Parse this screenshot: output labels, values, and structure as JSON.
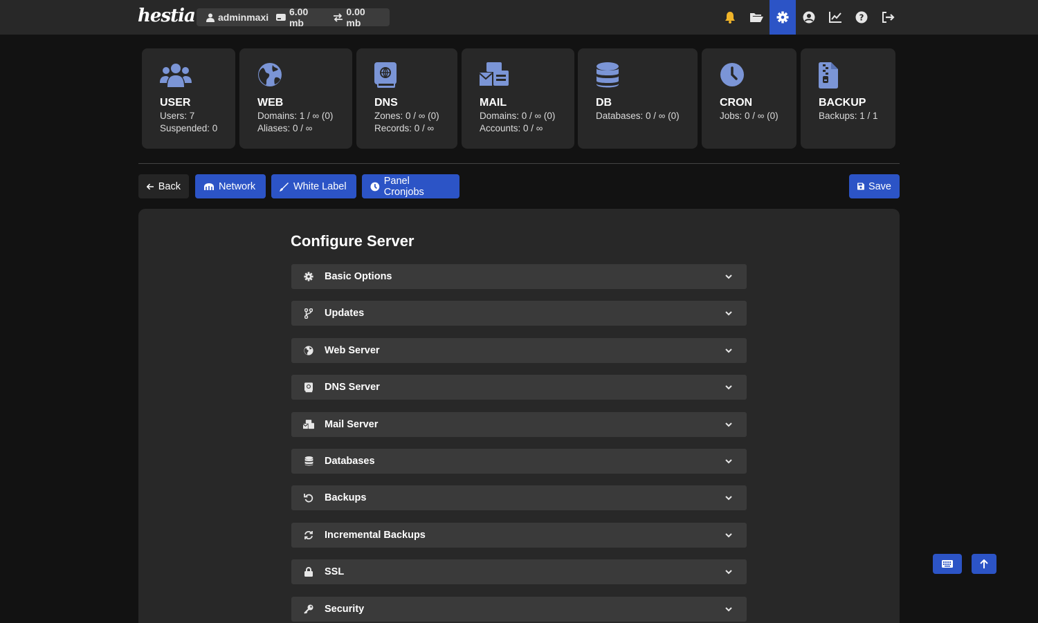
{
  "app": {
    "logo_text": "hestia"
  },
  "topbar": {
    "username": "adminmaxi",
    "disk": "6.00 mb",
    "bandwidth": "0.00 mb",
    "icons": [
      "bell-icon",
      "folder-icon",
      "gear-icon",
      "user-circle-icon",
      "chart-icon",
      "help-icon",
      "logout-icon"
    ],
    "accent": "#2c54c6",
    "bell_color": "#f0b429"
  },
  "stats": [
    {
      "title": "USER",
      "lines": [
        "Users: 7",
        "Suspended: 0"
      ],
      "icon": "users-icon"
    },
    {
      "title": "WEB",
      "lines": [
        "Domains: 1 / ∞ (0)",
        "Aliases: 0 / ∞"
      ],
      "icon": "globe-icon"
    },
    {
      "title": "DNS",
      "lines": [
        "Zones: 0 / ∞ (0)",
        "Records: 0 / ∞"
      ],
      "icon": "dns-book-icon"
    },
    {
      "title": "MAIL",
      "lines": [
        "Domains: 0 / ∞ (0)",
        "Accounts: 0 / ∞"
      ],
      "icon": "mail-bulk-icon"
    },
    {
      "title": "DB",
      "lines": [
        "Databases: 0 / ∞ (0)"
      ],
      "icon": "database-icon"
    },
    {
      "title": "CRON",
      "lines": [
        "Jobs: 0 / ∞ (0)"
      ],
      "icon": "clock-icon"
    },
    {
      "title": "BACKUP",
      "lines": [
        "Backups: 1 / 1"
      ],
      "icon": "file-zipper-icon"
    }
  ],
  "toolbar": {
    "back": "Back",
    "network": "Network",
    "white_label": "White Label",
    "panel_cronjobs": "Panel Cronjobs",
    "save": "Save"
  },
  "main": {
    "title": "Configure Server",
    "sections": [
      {
        "label": "Basic Options",
        "icon": "gear-icon"
      },
      {
        "label": "Updates",
        "icon": "code-branch-icon"
      },
      {
        "label": "Web Server",
        "icon": "globe-icon"
      },
      {
        "label": "DNS Server",
        "icon": "dns-book-icon"
      },
      {
        "label": "Mail Server",
        "icon": "mail-bulk-icon"
      },
      {
        "label": "Databases",
        "icon": "database-icon"
      },
      {
        "label": "Backups",
        "icon": "rotate-left-icon"
      },
      {
        "label": "Incremental Backups",
        "icon": "arrows-rotate-icon"
      },
      {
        "label": "SSL",
        "icon": "lock-icon"
      },
      {
        "label": "Security",
        "icon": "key-icon"
      }
    ]
  },
  "floating": {
    "keyboard": "keyboard-icon",
    "top": "arrow-up-icon"
  }
}
